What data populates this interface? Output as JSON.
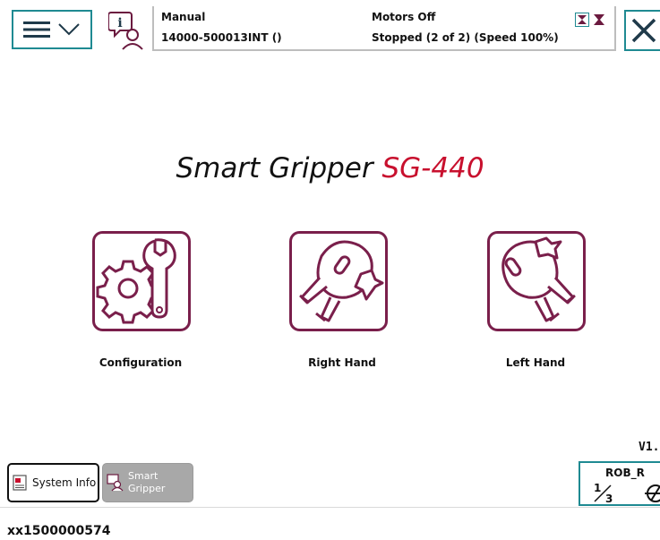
{
  "header": {
    "mode": "Manual",
    "system_name": "14000-500013INT ()",
    "motor_state": "Motors Off",
    "program_state": "Stopped (2 of 2) (Speed 100%)"
  },
  "main": {
    "title_prefix": "Smart Gripper ",
    "title_model": "SG-440",
    "tiles": [
      {
        "label": "Configuration",
        "icon": "gear-wrench-icon"
      },
      {
        "label": "Right Hand",
        "icon": "right-hand-gripper-icon"
      },
      {
        "label": "Left Hand",
        "icon": "left-hand-gripper-icon"
      }
    ]
  },
  "footer": {
    "version": "V1.",
    "taskbar": [
      {
        "label": "System Info",
        "active": true
      },
      {
        "label": "Smart\nGripper",
        "active": false
      }
    ],
    "rob_label": "ROB_R",
    "fraction": "1/3"
  },
  "caption": "xx1500000574",
  "colors": {
    "accent_teal": "#1f8a92",
    "brand_red": "#c8102e",
    "icon_maroon": "#7a1f4b"
  }
}
